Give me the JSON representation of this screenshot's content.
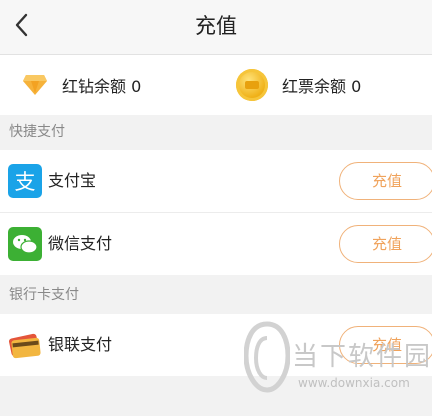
{
  "header": {
    "title": "充值",
    "back_icon": "chevron-left-icon"
  },
  "balances": {
    "diamond": {
      "text": "红钻余额 0",
      "icon": "diamond-icon"
    },
    "ticket": {
      "text": "红票余额 0",
      "icon": "coin-icon"
    }
  },
  "sections": {
    "quick_pay": {
      "title": "快捷支付",
      "items": [
        {
          "label": "支付宝",
          "button": "充值",
          "icon": "alipay-icon"
        },
        {
          "label": "微信支付",
          "button": "充值",
          "icon": "wechat-icon"
        }
      ]
    },
    "bank_pay": {
      "title": "银行卡支付",
      "items": [
        {
          "label": "银联支付",
          "button": "充值",
          "icon": "unionpay-card-icon"
        }
      ]
    }
  },
  "watermark": {
    "name": "当下软件园",
    "url": "www.downxia.com"
  },
  "colors": {
    "accent": "#f0a35c",
    "alipay": "#1aa3e8",
    "wechat": "#3cb034"
  }
}
